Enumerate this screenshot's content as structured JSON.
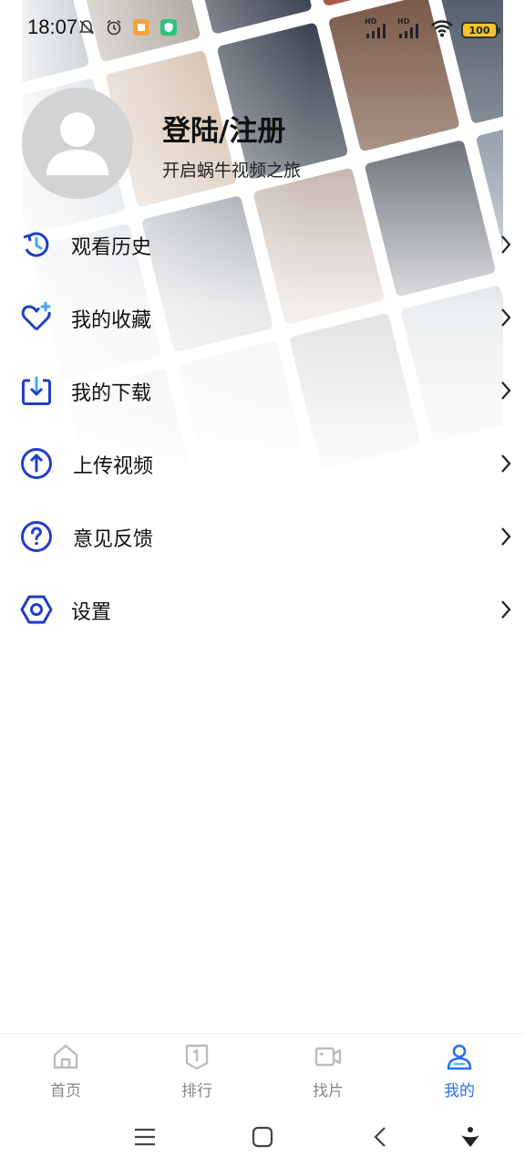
{
  "status_bar": {
    "time": "18:07",
    "battery": "100",
    "signal_label_1": "HD",
    "signal_label_2": "HD"
  },
  "profile": {
    "title": "登陆/注册",
    "subtitle": "开启蜗牛视频之旅"
  },
  "menu": [
    {
      "label": "观看历史",
      "icon": "history-icon"
    },
    {
      "label": "我的收藏",
      "icon": "favorite-heart-icon"
    },
    {
      "label": "我的下载",
      "icon": "download-icon"
    },
    {
      "label": "上传视频",
      "icon": "upload-icon"
    },
    {
      "label": "意见反馈",
      "icon": "feedback-question-icon"
    },
    {
      "label": "设置",
      "icon": "settings-hexagon-icon"
    }
  ],
  "bottom_nav": [
    {
      "label": "首页",
      "icon": "home-icon",
      "active": false
    },
    {
      "label": "排行",
      "icon": "ranking-icon",
      "active": false
    },
    {
      "label": "找片",
      "icon": "video-camera-icon",
      "active": false
    },
    {
      "label": "我的",
      "icon": "user-icon",
      "active": true
    }
  ],
  "colors": {
    "accent": "#2472e8",
    "icon_blue": "#1f3fc4",
    "inactive": "#888888",
    "avatar_bg": "#d3d3d3"
  }
}
